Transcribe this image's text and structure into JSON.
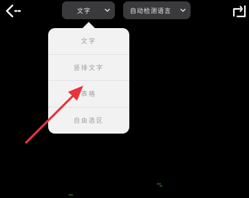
{
  "toolbar": {
    "back_icon": "back-arrow-icon",
    "recognition_mode": "文字",
    "language_mode": "自动检测语言",
    "share_icon": "share-icon"
  },
  "menu": {
    "items": [
      {
        "label": "文字"
      },
      {
        "label": "竖排文字"
      },
      {
        "label": "表格"
      },
      {
        "label": "自由选区"
      }
    ]
  },
  "annotation": {
    "arrow_color": "#e8343a",
    "arrow_target": "表格"
  },
  "colors": {
    "background": "#000000",
    "pill": "#3a3a3c",
    "menu": "#f2f2f3",
    "menu_text": "#9a9a9a"
  }
}
